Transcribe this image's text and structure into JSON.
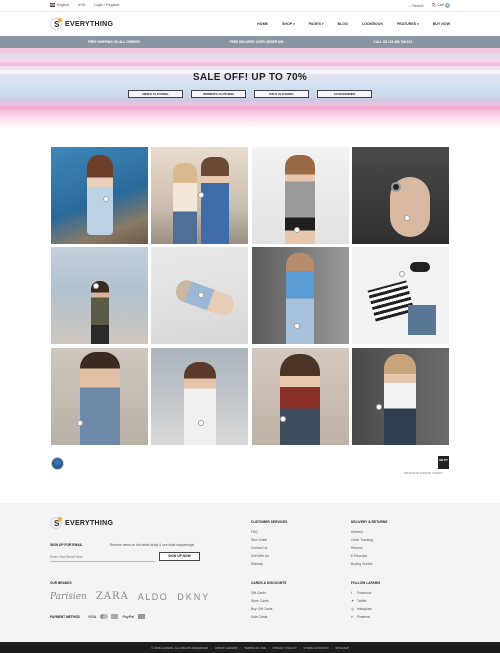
{
  "topbar": {
    "language": "English",
    "currency": "USD",
    "account": "Login / Register",
    "search": "Search",
    "cart": "Cart",
    "cart_count": "0"
  },
  "header": {
    "logo_text": "EVERYTHING",
    "nav": [
      "HOME",
      "SHOP",
      "PAGES",
      "BLOG",
      "LOOKBOOK",
      "FEATURES",
      "BUY NOW"
    ]
  },
  "strip": {
    "items": [
      "FREE SHIPPING ON ALL ORDERS",
      "FREE DELIVERY OVER ORDER $90",
      "CALL US 123 456 789 012"
    ]
  },
  "hero": {
    "title": "SALE OFF! UP TO 70%",
    "buttons": [
      "MEN'S CLOTHING",
      "WOMEN'S CLOTHING",
      "KID'S CLOTHING",
      "ACCESSORIES"
    ]
  },
  "instagram": {
    "credit": "INSTAGRAM SHOP BY SNAPPT",
    "snap_logo": "SN PT"
  },
  "footer": {
    "logo_text": "EVERYTHING",
    "signup_label": "SIGN UP FOR EMAIL",
    "signup_text": "Receive news on the latest deals & see what happenings!",
    "email_placeholder": "Enter Your Email Here",
    "signup_button": "SIGN UP NOW",
    "brands_label": "OUR BRANDS",
    "brands": [
      "Parisien",
      "ZARA",
      "ALDO",
      "DKNY"
    ],
    "payment_label": "PAYMENT METHOD",
    "payments": [
      "VISA",
      "PayPal"
    ],
    "customer_services": {
      "title": "CUSTOMER SERVICES",
      "items": [
        "FAQ",
        "Size Guide",
        "Contact Us",
        "Sell With Us",
        "Sitemap"
      ]
    },
    "cards_discounts": {
      "title": "CARDS & DISCOUNTS",
      "items": [
        "Gift Cards",
        "Store Cards",
        "Buy Gift Cards",
        "Sale Cards"
      ]
    },
    "delivery_returns": {
      "title": "DELIVERY & RETURNS",
      "items": [
        "Delivery",
        "Order Tracking",
        "Returns",
        "E-Receipts",
        "Buying Guides"
      ]
    },
    "follow": {
      "title": "FOLLOW LAFARIS",
      "items": [
        "Facebook",
        "Twitter",
        "Instagram",
        "Pinterest"
      ]
    }
  },
  "bottombar": {
    "items": [
      "© 2018 LAFARIS. ALL RIGHTS RESERVED",
      "ABOUT LAFARIS",
      "TERMS OF USE",
      "PRIVACY POLICY",
      "STORE LOCATION",
      "SITE MAP"
    ]
  },
  "colors": {
    "strip": "#8a96a2",
    "footer_bg": "#f4f4f4",
    "bottombar": "#1d1d1d",
    "accent": "#f3b13b"
  }
}
